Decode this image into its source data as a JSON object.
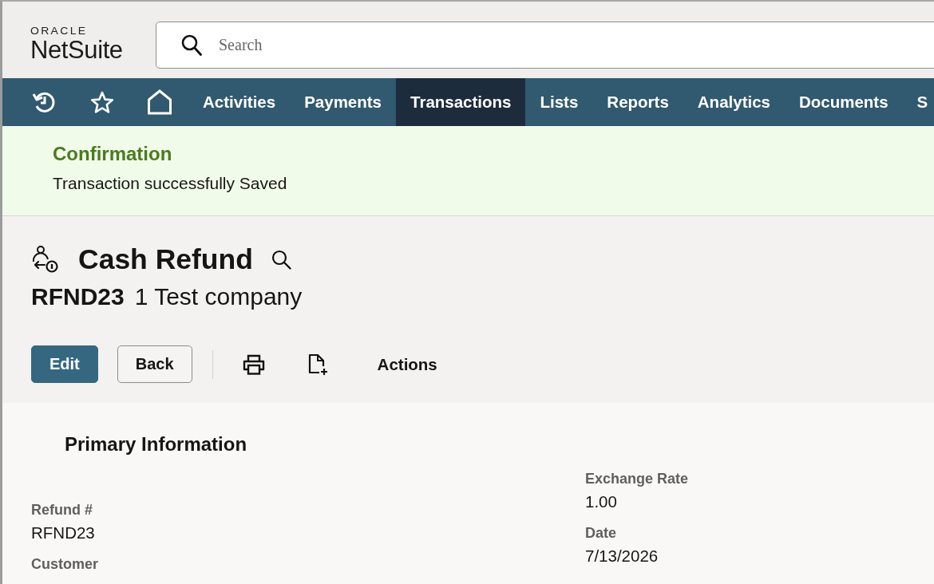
{
  "logo": {
    "brand": "ORACLE",
    "product": "NetSuite"
  },
  "search": {
    "placeholder": "Search"
  },
  "nav": {
    "items": [
      {
        "label": "Activities",
        "selected": false
      },
      {
        "label": "Payments",
        "selected": false
      },
      {
        "label": "Transactions",
        "selected": true
      },
      {
        "label": "Lists",
        "selected": false
      },
      {
        "label": "Reports",
        "selected": false
      },
      {
        "label": "Analytics",
        "selected": false
      },
      {
        "label": "Documents",
        "selected": false
      },
      {
        "label": "S",
        "selected": false
      }
    ]
  },
  "confirmation": {
    "title": "Confirmation",
    "message": "Transaction successfully Saved"
  },
  "record": {
    "type": "Cash Refund",
    "number": "RFND23",
    "entity": "1 Test company"
  },
  "buttons": [
    {
      "label": "Edit",
      "kind": "primary"
    },
    {
      "label": "Back",
      "kind": "secondary"
    }
  ],
  "actions": {
    "label": "Actions"
  },
  "section": {
    "title": "Primary Information",
    "columns": [
      [
        {
          "label": "Refund #",
          "value": "RFND23"
        },
        {
          "label": "Customer"
        }
      ],
      [
        {
          "label": "Exchange Rate",
          "value": "1.00"
        },
        {
          "label": "Date",
          "value": "7/13/2026"
        }
      ]
    ]
  }
}
